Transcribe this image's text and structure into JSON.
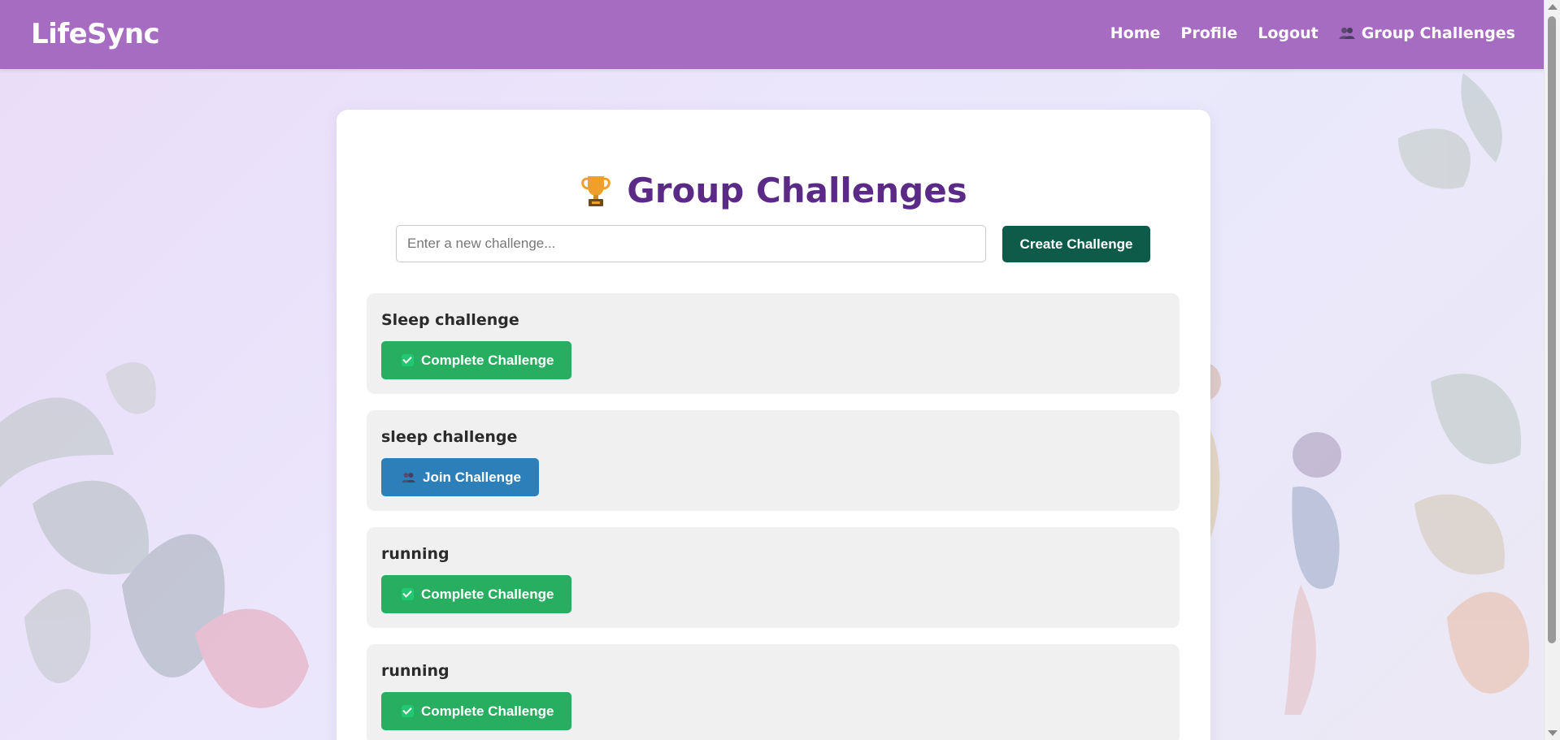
{
  "app": {
    "brand": "LifeSync"
  },
  "nav": {
    "links": [
      {
        "label": "Home"
      },
      {
        "label": "Profile"
      },
      {
        "label": "Logout"
      },
      {
        "label": "Group Challenges",
        "icon": "people-icon"
      }
    ]
  },
  "page": {
    "title": "Group Challenges",
    "title_icon": "trophy-icon",
    "input_placeholder": "Enter a new challenge...",
    "input_value": "",
    "create_label": "Create Challenge"
  },
  "challenges": [
    {
      "name": "Sleep challenge",
      "action": "Complete Challenge",
      "type": "complete"
    },
    {
      "name": "sleep challenge",
      "action": "Join Challenge",
      "type": "join"
    },
    {
      "name": "running",
      "action": "Complete Challenge",
      "type": "complete"
    },
    {
      "name": "running",
      "action": "Complete Challenge",
      "type": "complete"
    }
  ],
  "colors": {
    "navbar": "#a66cc1",
    "title": "#5b2a86",
    "create_button": "#0f5b4a",
    "complete_button": "#27ae60",
    "join_button": "#2d7fba"
  }
}
